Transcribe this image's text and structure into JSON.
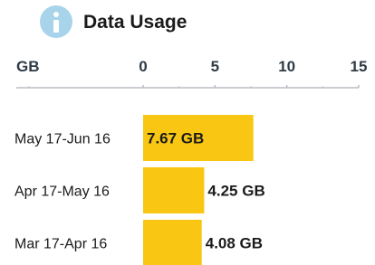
{
  "header": {
    "title": "Data Usage",
    "icon": "info-icon"
  },
  "colors": {
    "bar": "#f9c713",
    "icon": "#a7d4ea",
    "axis": "#b9bec3",
    "text": "#1b1b1b"
  },
  "chart_data": {
    "type": "bar",
    "orientation": "horizontal",
    "title": "Data Usage",
    "axis_unit": "GB",
    "xlim": [
      0,
      15
    ],
    "x_ticks": [
      0,
      5,
      10,
      15
    ],
    "x_tick_labels": [
      "0",
      "5",
      "10",
      "15"
    ],
    "categories": [
      "May 17-Jun 16",
      "Apr 17-May 16",
      "Mar 17-Apr 16"
    ],
    "values": [
      7.67,
      4.25,
      4.08
    ],
    "data_labels": [
      "7.67 GB",
      "4.25 GB",
      "4.08 GB"
    ],
    "grid": false,
    "legend": "none"
  }
}
